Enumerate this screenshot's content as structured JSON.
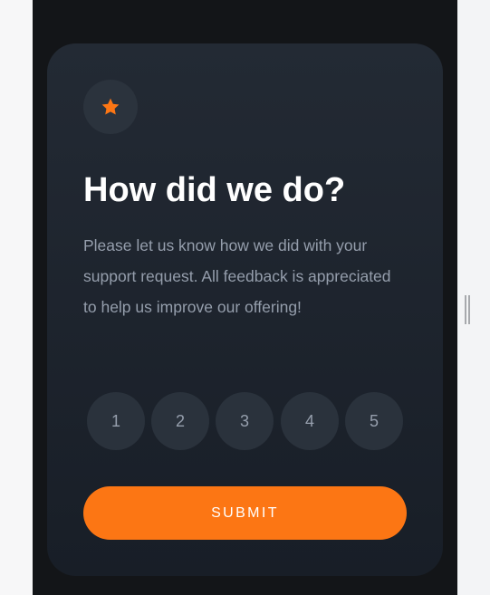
{
  "card": {
    "icon": "star-icon",
    "title": "How did we do?",
    "description": "Please let us know how we did with your support request. All feedback is appreciated to help us improve our offering!",
    "ratings": [
      "1",
      "2",
      "3",
      "4",
      "5"
    ],
    "submit_label": "SUBMIT"
  },
  "colors": {
    "accent": "#fc7614",
    "card_background": "#232a34",
    "rating_background": "#2a323c",
    "page_background": "#131518",
    "title_text": "#ffffff",
    "body_text": "#959eac"
  }
}
